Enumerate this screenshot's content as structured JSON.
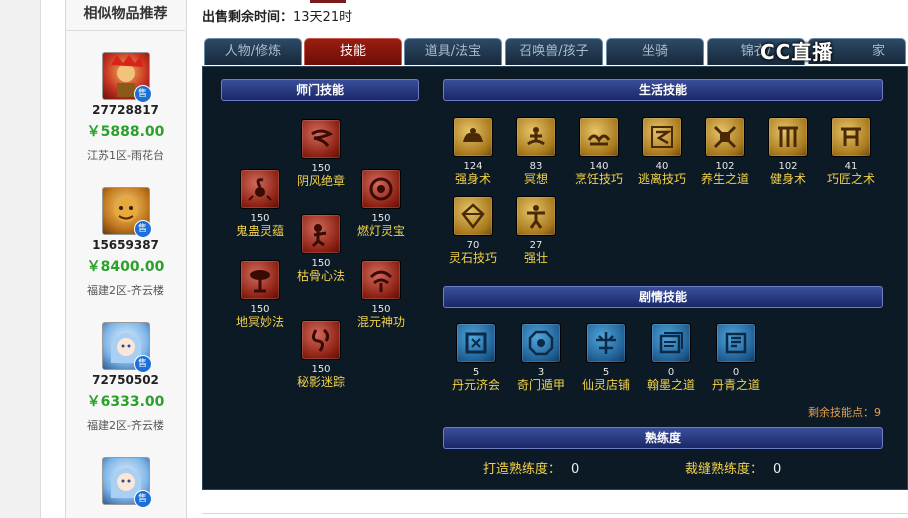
{
  "sidebar": {
    "title": "相似物品推荐",
    "items": [
      {
        "id": "27728817",
        "price": "￥5888.00",
        "server": "江苏1区-雨花台",
        "badge": "售",
        "avatar": "lion-warrior-avatar"
      },
      {
        "id": "15659387",
        "price": "￥8400.00",
        "server": "福建2区-齐云楼",
        "badge": "售",
        "avatar": "tiger-king-avatar"
      },
      {
        "id": "72750502",
        "price": "￥6333.00",
        "server": "福建2区-齐云楼",
        "badge": "售",
        "avatar": "blue-hair-girl-avatar"
      },
      {
        "id": "",
        "price": "",
        "server": "",
        "badge": "售",
        "avatar": "blue-hair-girl-avatar"
      }
    ]
  },
  "sale_time": {
    "label": "出售剩余时间：",
    "value": "13天21时"
  },
  "tabs": [
    {
      "label": "人物/修炼",
      "active": false
    },
    {
      "label": "技能",
      "active": true
    },
    {
      "label": "道具/法宝",
      "active": false
    },
    {
      "label": "召唤兽/孩子",
      "active": false
    },
    {
      "label": "坐骑",
      "active": false
    },
    {
      "label": "锦衣/",
      "active": false
    },
    {
      "label": "家",
      "active": false
    }
  ],
  "watermark": "CC直播",
  "sections": {
    "school": {
      "title": "师门技能"
    },
    "life": {
      "title": "生活技能"
    },
    "plot": {
      "title": "剧情技能"
    },
    "proficiency": {
      "title": "熟练度"
    }
  },
  "school_skills": [
    {
      "level": "150",
      "name": "阴风绝章",
      "icon": "wind-icon"
    },
    {
      "level": "150",
      "name": "鬼蛊灵蕴",
      "icon": "scorpion-icon"
    },
    {
      "level": "150",
      "name": "燃灯灵宝",
      "icon": "lamp-icon"
    },
    {
      "level": "150",
      "name": "枯骨心法",
      "icon": "skeleton-icon"
    },
    {
      "level": "150",
      "name": "地冥妙法",
      "icon": "tree-icon"
    },
    {
      "level": "150",
      "name": "混元神功",
      "icon": "spirit-icon"
    },
    {
      "level": "150",
      "name": "秘影迷踪",
      "icon": "shadow-icon"
    }
  ],
  "life_skills": [
    {
      "level": "124",
      "name": "强身术",
      "icon": "muscle-icon"
    },
    {
      "level": "83",
      "name": "冥想",
      "icon": "meditate-icon"
    },
    {
      "level": "140",
      "name": "烹饪技巧",
      "icon": "cooking-icon"
    },
    {
      "level": "40",
      "name": "逃离技巧",
      "icon": "escape-icon"
    },
    {
      "level": "102",
      "name": "养生之道",
      "icon": "health-icon"
    },
    {
      "level": "102",
      "name": "健身术",
      "icon": "fitness-icon"
    },
    {
      "level": "41",
      "name": "巧匠之术",
      "icon": "craft-icon"
    },
    {
      "level": "70",
      "name": "灵石技巧",
      "icon": "gem-icon"
    },
    {
      "level": "27",
      "name": "强壮",
      "icon": "strong-icon"
    }
  ],
  "plot_skills": [
    {
      "level": "5",
      "name": "丹元济会",
      "icon": "elixir-icon"
    },
    {
      "level": "3",
      "name": "奇门遁甲",
      "icon": "portal-icon"
    },
    {
      "level": "5",
      "name": "仙灵店铺",
      "icon": "shop-icon"
    },
    {
      "level": "0",
      "name": "翰墨之道",
      "icon": "book-icon"
    },
    {
      "level": "0",
      "name": "丹青之道",
      "icon": "scroll-icon"
    }
  ],
  "remaining_points": "剩余技能点：9",
  "proficiency": {
    "forge_label": "打造熟练度：",
    "forge_value": "0",
    "tailor_label": "裁缝熟练度：",
    "tailor_value": "0"
  }
}
